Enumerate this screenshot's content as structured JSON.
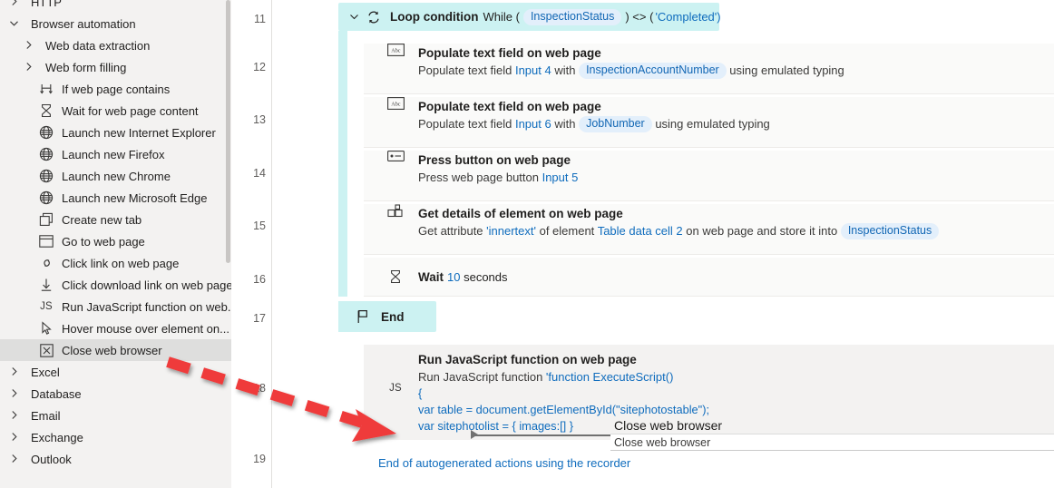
{
  "sidebar": {
    "items": [
      {
        "label": "HTTP",
        "icon": "chevron-right-icon",
        "kind": "group",
        "indent": 0,
        "expanded": false,
        "selected": false,
        "clipped": true
      },
      {
        "label": "Browser automation",
        "icon": "chevron-down-icon",
        "kind": "group",
        "indent": 0,
        "expanded": true,
        "selected": false
      },
      {
        "label": "Web data extraction",
        "icon": "chevron-right-icon",
        "kind": "group",
        "indent": 1,
        "expanded": false,
        "selected": false
      },
      {
        "label": "Web form filling",
        "icon": "chevron-right-icon",
        "kind": "group",
        "indent": 1,
        "expanded": false,
        "selected": false
      },
      {
        "label": "If web page contains",
        "icon": "branch-icon",
        "kind": "action",
        "indent": 2,
        "selected": false
      },
      {
        "label": "Wait for web page content",
        "icon": "hourglass-icon",
        "kind": "action",
        "indent": 2,
        "selected": false
      },
      {
        "label": "Launch new Internet Explorer",
        "icon": "globe-icon",
        "kind": "action",
        "indent": 2,
        "selected": false
      },
      {
        "label": "Launch new Firefox",
        "icon": "globe-icon",
        "kind": "action",
        "indent": 2,
        "selected": false
      },
      {
        "label": "Launch new Chrome",
        "icon": "globe-icon",
        "kind": "action",
        "indent": 2,
        "selected": false
      },
      {
        "label": "Launch new Microsoft Edge",
        "icon": "globe-icon",
        "kind": "action",
        "indent": 2,
        "selected": false
      },
      {
        "label": "Create new tab",
        "icon": "copy-window-icon",
        "kind": "action",
        "indent": 2,
        "selected": false
      },
      {
        "label": "Go to web page",
        "icon": "window-icon",
        "kind": "action",
        "indent": 2,
        "selected": false
      },
      {
        "label": "Click link on web page",
        "icon": "link-icon",
        "kind": "action",
        "indent": 2,
        "selected": false
      },
      {
        "label": "Click download link on web page",
        "icon": "download-icon",
        "kind": "action",
        "indent": 2,
        "selected": false
      },
      {
        "label": "Run JavaScript function on web...",
        "icon": "js-icon",
        "kind": "action",
        "indent": 2,
        "selected": false
      },
      {
        "label": "Hover mouse over element on...",
        "icon": "cursor-icon",
        "kind": "action",
        "indent": 2,
        "selected": false
      },
      {
        "label": "Close web browser",
        "icon": "close-box-icon",
        "kind": "action",
        "indent": 2,
        "selected": true
      },
      {
        "label": "Excel",
        "icon": "chevron-right-icon",
        "kind": "group",
        "indent": 0,
        "expanded": false,
        "selected": false
      },
      {
        "label": "Database",
        "icon": "chevron-right-icon",
        "kind": "group",
        "indent": 0,
        "expanded": false,
        "selected": false
      },
      {
        "label": "Email",
        "icon": "chevron-right-icon",
        "kind": "group",
        "indent": 0,
        "expanded": false,
        "selected": false
      },
      {
        "label": "Exchange",
        "icon": "chevron-right-icon",
        "kind": "group",
        "indent": 0,
        "expanded": false,
        "selected": false
      },
      {
        "label": "Outlook",
        "icon": "chevron-right-icon",
        "kind": "group",
        "indent": 0,
        "expanded": false,
        "selected": false
      }
    ]
  },
  "workspace": {
    "line_numbers": [
      "11",
      "12",
      "13",
      "14",
      "15",
      "16",
      "17",
      "18",
      "19"
    ],
    "loop": {
      "title": "Loop condition",
      "prefix": "While (",
      "variable": "InspectionStatus",
      "operator": ") <> (",
      "value": "'Completed')",
      "icon": "loop-icon",
      "chevron": "chevron-down-icon",
      "background": "#CCF2F2"
    },
    "steps": [
      {
        "icon": "abc-textfield-icon",
        "title": "Populate text field on web page",
        "desc_pre": "Populate text field ",
        "desc_link": "Input 4",
        "desc_mid": " with ",
        "desc_pill": "InspectionAccountNumber",
        "desc_post": " using emulated typing"
      },
      {
        "icon": "abc-textfield-icon",
        "title": "Populate text field on web page",
        "desc_pre": "Populate text field ",
        "desc_link": "Input 6",
        "desc_mid": " with ",
        "desc_pill": "JobNumber",
        "desc_post": " using emulated typing"
      },
      {
        "icon": "button-icon",
        "title": "Press button on web page",
        "desc_pre": "Press web page button ",
        "desc_link": "Input 5",
        "desc_mid": "",
        "desc_pill": "",
        "desc_post": ""
      },
      {
        "icon": "element-details-icon",
        "title": "Get details of element on web page",
        "desc_pre": "Get attribute ",
        "desc_link": "'innertext'",
        "desc_mid": " of element ",
        "desc_link2": "Table data cell 2",
        "desc_mid2": " on web page and store it into ",
        "desc_pill": "InspectionStatus",
        "desc_post": ""
      }
    ],
    "wait_step": {
      "icon": "hourglass-icon",
      "label": "Wait",
      "value": "10",
      "unit": "seconds"
    },
    "end_block": {
      "icon": "flag-icon",
      "label": "End",
      "background": "#CCF2F2"
    },
    "js_step": {
      "icon_text": "JS",
      "title": "Run JavaScript function on web page",
      "desc_prefix": "Run JavaScript function ",
      "code_lines": [
        "'function ExecuteScript()",
        "{",
        "var table = document.getElementById(\"sitephotostable\");",
        "var sitephotolist = { images:[] }"
      ]
    },
    "drag_ghost": {
      "title": "Close web browser",
      "subtitle": "Close web browser"
    },
    "footer_link": "End of autogenerated actions using the recorder",
    "annotation": {
      "kind": "red-dashed-arrow",
      "color": "#ef3b3b"
    }
  }
}
